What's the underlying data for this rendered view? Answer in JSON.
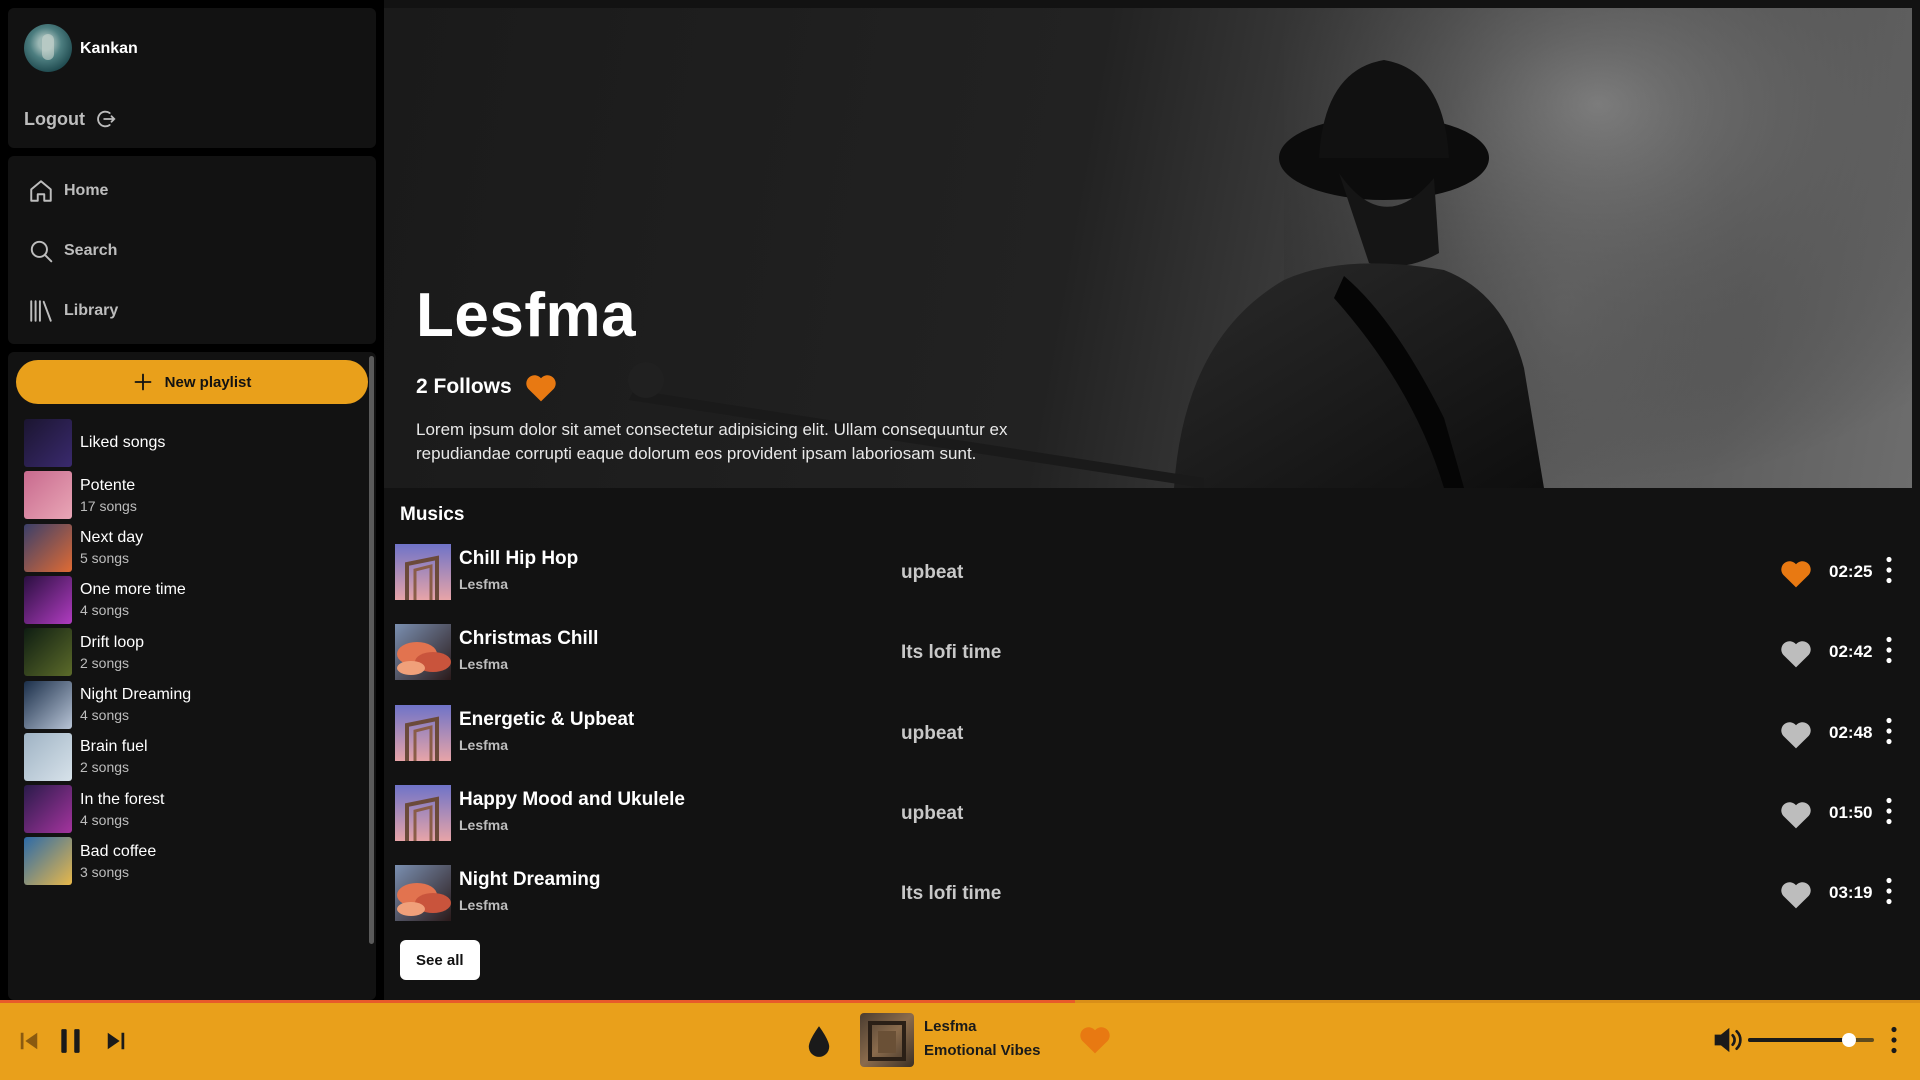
{
  "colors": {
    "accent": "#e9a01b",
    "like_active": "#e87912",
    "like_inactive": "#bdbdbd",
    "panel": "#121212",
    "progress": "#e85a2a"
  },
  "user": {
    "name": "Kankan",
    "logout_label": "Logout"
  },
  "nav": [
    {
      "label": "Home",
      "icon": "home-icon"
    },
    {
      "label": "Search",
      "icon": "search-icon"
    },
    {
      "label": "Library",
      "icon": "library-icon"
    }
  ],
  "library": {
    "new_playlist_label": "New playlist",
    "playlists": [
      {
        "name": "Liked songs",
        "count": "",
        "colors": [
          "#1b1530",
          "#3a2a6e"
        ]
      },
      {
        "name": "Potente",
        "count": "17 songs",
        "colors": [
          "#c86a8e",
          "#e9a6b6"
        ]
      },
      {
        "name": "Next day",
        "count": "5 songs",
        "colors": [
          "#3a3f6a",
          "#e06b34"
        ]
      },
      {
        "name": "One more time",
        "count": "4 songs",
        "colors": [
          "#2a0f40",
          "#b03cc0"
        ]
      },
      {
        "name": "Drift loop",
        "count": "2 songs",
        "colors": [
          "#0e1d12",
          "#5c6b2a"
        ]
      },
      {
        "name": "Night Dreaming",
        "count": "4 songs",
        "colors": [
          "#1b2f4a",
          "#b8c4d6"
        ]
      },
      {
        "name": "Brain fuel",
        "count": "2 songs",
        "colors": [
          "#9fb3c4",
          "#d7e2ea"
        ]
      },
      {
        "name": "In the forest",
        "count": "4 songs",
        "colors": [
          "#2a1b4a",
          "#a4349e"
        ]
      },
      {
        "name": "Bad coffee",
        "count": "3 songs",
        "colors": [
          "#2c6aa8",
          "#e8b84a"
        ]
      }
    ]
  },
  "artist": {
    "name": "Lesfma",
    "follows": "2 Follows",
    "bio": "Lorem ipsum dolor sit amet consectetur adipisicing elit. Ullam consequuntur ex repudiandae corrupti eaque dolorum eos provident ipsam laboriosam sunt."
  },
  "musics": {
    "section_title": "Musics",
    "see_all_label": "See all",
    "tracks": [
      {
        "title": "Chill Hip Hop",
        "artist": "Lesfma",
        "album": "upbeat",
        "duration": "02:25",
        "liked": true,
        "cover": "frame"
      },
      {
        "title": "Christmas Chill",
        "artist": "Lesfma",
        "album": "Its lofi time",
        "duration": "02:42",
        "liked": false,
        "cover": "clouds"
      },
      {
        "title": "Energetic & Upbeat",
        "artist": "Lesfma",
        "album": "upbeat",
        "duration": "02:48",
        "liked": false,
        "cover": "frame"
      },
      {
        "title": "Happy Mood and Ukulele",
        "artist": "Lesfma",
        "album": "upbeat",
        "duration": "01:50",
        "liked": false,
        "cover": "frame"
      },
      {
        "title": "Night Dreaming",
        "artist": "Lesfma",
        "album": "Its lofi time",
        "duration": "03:19",
        "liked": false,
        "cover": "clouds"
      }
    ]
  },
  "player": {
    "artist": "Lesfma",
    "title": "Emotional Vibes",
    "liked": true,
    "progress": 0.56,
    "volume": 0.8
  }
}
